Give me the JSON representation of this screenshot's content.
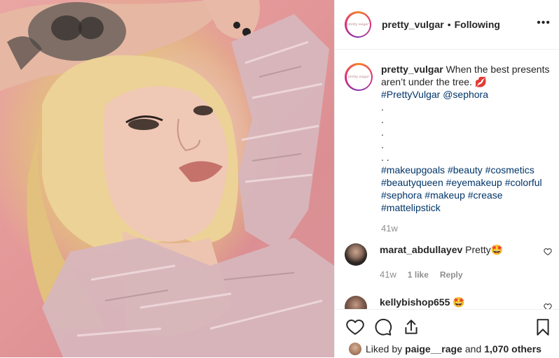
{
  "post": {
    "username": "pretty_vulgar",
    "separator": "•",
    "follow_status": "Following",
    "avatar_logo_text": "pretty vulgar",
    "more_icon": "more-options-icon"
  },
  "caption": {
    "username": "pretty_vulgar",
    "text": " When the best presents aren’t under the tree. 💋",
    "line_tags": [
      "#PrettyVulgar",
      "@sephora"
    ],
    "dots": [
      ".",
      ".",
      ".",
      ".",
      ". ."
    ],
    "hashtags": [
      "#makeupgoals",
      "#beauty",
      "#cosmetics",
      "#beautyqueen",
      "#eyemakeup",
      "#colorful",
      "#sephora",
      "#makeup",
      "#crease",
      "#mattelipstick"
    ],
    "time": "41w"
  },
  "comments": [
    {
      "username": "marat_abdullayev",
      "text": " Pretty🤩",
      "time": "41w",
      "likes": "1 like",
      "reply": "Reply"
    },
    {
      "username": "kellybishop655",
      "text": " 🤩",
      "time": "",
      "likes": "",
      "reply": ""
    }
  ],
  "actions": {
    "like_icon": "heart-icon",
    "comment_icon": "comment-icon",
    "share_icon": "share-icon",
    "save_icon": "bookmark-icon"
  },
  "likes": {
    "prefix": "Liked by",
    "user": "paige__rage",
    "conj": "and",
    "others": "1,070 others"
  },
  "colors": {
    "link": "#003569",
    "meta_gray": "#8e8e8e",
    "text": "#262626",
    "border": "#efefef",
    "photo_bg": "#e59a9a"
  }
}
